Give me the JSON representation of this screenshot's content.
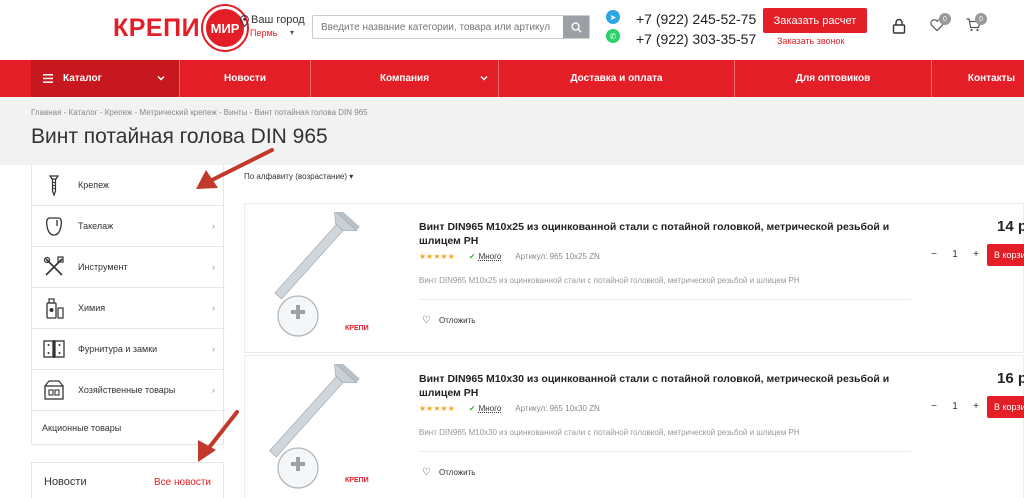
{
  "header": {
    "logo_text": "КРЕПИ",
    "logo_circle_text": "МИР",
    "city_label": "Ваш город",
    "city_name": "Пермь",
    "search_placeholder": "Введите название категории, товара или артикул",
    "phone1": "+7 (922) 245-52-75",
    "phone2": "+7 (922) 303-35-57",
    "order_button": "Заказать расчет",
    "order_call": "Заказать звонок",
    "favorites_count": "0",
    "cart_count": "0"
  },
  "nav": {
    "catalog": "Каталог",
    "news": "Новости",
    "company": "Компания",
    "delivery": "Доставка и оплата",
    "wholesale": "Для оптовиков",
    "contacts": "Контакты"
  },
  "breadcrumb": "Главная - Каталог - Крепеж - Метрический крепеж - Винты - Винт потайная голова DIN 965",
  "page_title": "Винт потайная голова DIN 965",
  "sidebar": {
    "items": [
      {
        "label": "Крепеж",
        "icon": "screw-icon"
      },
      {
        "label": "Такелаж",
        "icon": "carabiner-icon"
      },
      {
        "label": "Инструмент",
        "icon": "tools-icon"
      },
      {
        "label": "Химия",
        "icon": "chemistry-icon"
      },
      {
        "label": "Фурнитура и замки",
        "icon": "hinge-icon"
      },
      {
        "label": "Хозяйственные товары",
        "icon": "household-icon"
      }
    ],
    "promo": "Акционные товары"
  },
  "news": {
    "title": "Новости",
    "all": "Все новости"
  },
  "sort_label": "По алфавиту (возрастание)",
  "products": [
    {
      "title": "Винт DIN965 M10x25 из оцинкованной стали с потайной головкой, метрической резьбой и шлицем PH",
      "availability": "Много",
      "sku": "Артикул: 965 10x25 ZN",
      "description": "Винт DIN965 M10x25 из оцинкованной стали с потайной головкой, метрической резьбой и шлицем PH",
      "favorite": "Отложить",
      "price": "14 р",
      "qty": "1",
      "buy": "В корзину",
      "rating": 5
    },
    {
      "title": "Винт DIN965 M10x30 из оцинкованной стали с потайной головкой, метрической резьбой и шлицем PH",
      "availability": "Много",
      "sku": "Артикул: 965 10x30 ZN",
      "description": "Винт DIN965 M10x30 из оцинкованной стали с потайной головкой, метрической резьбой и шлицем PH",
      "favorite": "Отложить",
      "price": "16 р",
      "qty": "1",
      "buy": "В корзину",
      "rating": 5
    }
  ],
  "colors": {
    "accent": "#e41e26",
    "annotation_arrow": "#c0392b"
  }
}
